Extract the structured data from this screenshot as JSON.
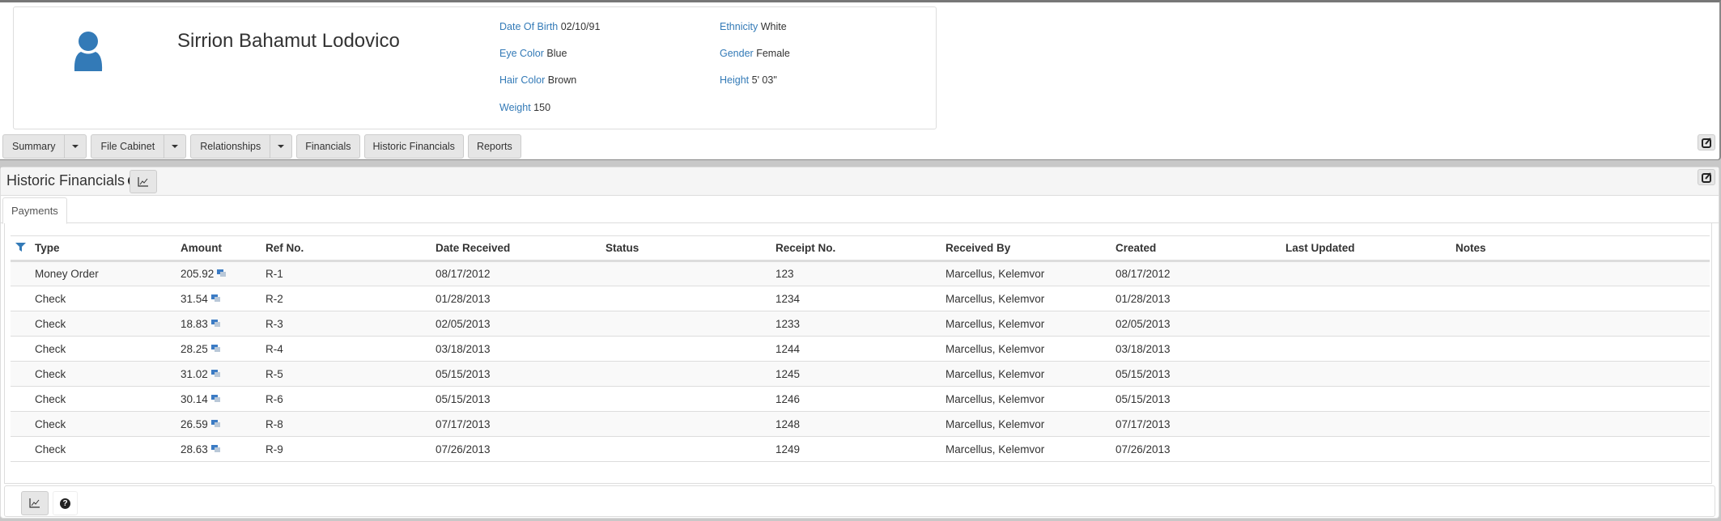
{
  "person": {
    "name": "Sirrion Bahamut Lodovico",
    "details": [
      {
        "label": "Date Of Birth",
        "value": "02/10/91"
      },
      {
        "label": "Eye Color",
        "value": "Blue"
      },
      {
        "label": "Hair Color",
        "value": "Brown"
      },
      {
        "label": "Weight",
        "value": "150"
      },
      {
        "label": "Ethnicity",
        "value": "White"
      },
      {
        "label": "Gender",
        "value": "Female"
      },
      {
        "label": "Height",
        "value": "5' 03\""
      }
    ]
  },
  "nav": {
    "summary": "Summary",
    "file_cabinet": "File Cabinet",
    "relationships": "Relationships",
    "financials": "Financials",
    "historic_financials": "Historic Financials",
    "reports": "Reports"
  },
  "panel": {
    "title": "Historic Financials",
    "help": "?",
    "tabs": [
      {
        "label": "Payments"
      }
    ]
  },
  "table": {
    "headers": [
      "Type",
      "Amount",
      "Ref No.",
      "Date Received",
      "Status",
      "Receipt No.",
      "Received By",
      "Created",
      "Last Updated",
      "Notes"
    ],
    "rows": [
      [
        "Money Order",
        "205.92",
        "R-1",
        "08/17/2012",
        "",
        "123",
        "Marcellus, Kelemvor",
        "08/17/2012",
        "",
        ""
      ],
      [
        "Check",
        "31.54",
        "R-2",
        "01/28/2013",
        "",
        "1234",
        "Marcellus, Kelemvor",
        "01/28/2013",
        "",
        ""
      ],
      [
        "Check",
        "18.83",
        "R-3",
        "02/05/2013",
        "",
        "1233",
        "Marcellus, Kelemvor",
        "02/05/2013",
        "",
        ""
      ],
      [
        "Check",
        "28.25",
        "R-4",
        "03/18/2013",
        "",
        "1244",
        "Marcellus, Kelemvor",
        "03/18/2013",
        "",
        ""
      ],
      [
        "Check",
        "31.02",
        "R-5",
        "05/15/2013",
        "",
        "1245",
        "Marcellus, Kelemvor",
        "05/15/2013",
        "",
        ""
      ],
      [
        "Check",
        "30.14",
        "R-6",
        "05/15/2013",
        "",
        "1246",
        "Marcellus, Kelemvor",
        "05/15/2013",
        "",
        ""
      ],
      [
        "Check",
        "26.59",
        "R-8",
        "07/17/2013",
        "",
        "1248",
        "Marcellus, Kelemvor",
        "07/17/2013",
        "",
        ""
      ],
      [
        "Check",
        "28.63",
        "R-9",
        "07/26/2013",
        "",
        "1249",
        "Marcellus, Kelemvor",
        "07/26/2013",
        "",
        ""
      ]
    ]
  },
  "footer": {
    "help": "?"
  },
  "colors": {
    "accent": "#337ab7",
    "avatar": "#337ab7"
  }
}
